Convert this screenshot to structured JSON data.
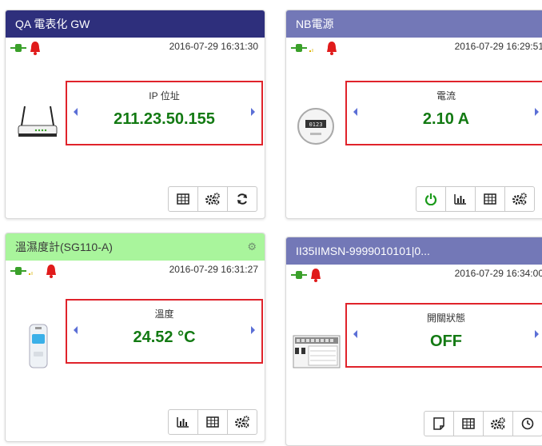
{
  "cards": [
    {
      "title": "QA 電表化 GW",
      "timestamp": "2016-07-29 16:31:30",
      "value_label": "IP 位址",
      "value": "211.23.50.155",
      "device": "router-image",
      "buttons": [
        "table-icon",
        "gears-icon",
        "refresh-icon"
      ]
    },
    {
      "title": "NB電源",
      "timestamp": "2016-07-29 16:29:51",
      "value_label": "電流",
      "value": "2.10 A",
      "device": "meter-image",
      "buttons": [
        "power-icon",
        "bar-chart-icon",
        "table-icon",
        "gears-icon"
      ]
    },
    {
      "title": "溫濕度計(SG110-A)",
      "timestamp": "2016-07-29 16:31:27",
      "value_label": "溫度",
      "value": "24.52 °C",
      "device": "thermometer-image",
      "buttons": [
        "bar-chart-icon",
        "table-icon",
        "gears-icon"
      ]
    },
    {
      "title": "II35IIMSN-9999010101|0...",
      "timestamp": "2016-07-29 16:34:00",
      "value_label": "開關狀態",
      "value": "OFF",
      "device": "switch-panel-image",
      "buttons": [
        "note-icon",
        "table-icon",
        "gears-icon",
        "clock-icon"
      ]
    }
  ],
  "colors": {
    "header_dark": "#2e2f7c",
    "header_mid": "#7378b7",
    "header_green": "#a9f59c",
    "value_green": "#137a13",
    "highlight_red": "#e0232b",
    "bell_red": "#e01b1b"
  }
}
